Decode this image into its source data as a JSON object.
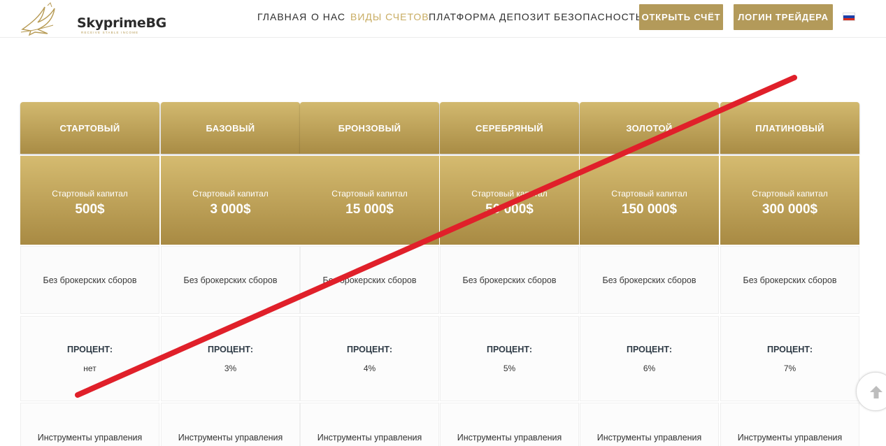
{
  "header": {
    "logo_text": "SkyprimeBG",
    "logo_tagline": "RECEIVE STABLE INCOME",
    "nav": [
      {
        "label": "ГЛАВНАЯ"
      },
      {
        "label": "О НАС"
      },
      {
        "label": "ВИДЫ СЧЕТОВ",
        "active": true
      },
      {
        "label": "ПЛАТФОРМА"
      },
      {
        "label": "ДЕПОЗИТ"
      },
      {
        "label": "БЕЗОПАСНОСТЬ"
      }
    ],
    "open_account_label": "ОТКРЫТЬ СЧЁТ",
    "trader_login_label": "ЛОГИН ТРЕЙДЕРА",
    "language_flag": "ru-flag-icon"
  },
  "accounts": [
    {
      "name": "СТАРТОВЫЙ",
      "capital_label": "Стартовый капитал",
      "capital": "500$",
      "fees": "Без брокерских сборов",
      "percent_label": "ПРОЦЕНТ:",
      "percent": "нет",
      "tools": "Инструменты управления"
    },
    {
      "name": "БАЗОВЫЙ",
      "capital_label": "Стартовый капитал",
      "capital": "3 000$",
      "fees": "Без брокерских сборов",
      "percent_label": "ПРОЦЕНТ:",
      "percent": "3%",
      "tools": "Инструменты управления"
    },
    {
      "name": "БРОНЗОВЫЙ",
      "capital_label": "Стартовый капитал",
      "capital": "15 000$",
      "fees": "Без брокерских сборов",
      "percent_label": "ПРОЦЕНТ:",
      "percent": "4%",
      "tools": "Инструменты управления"
    },
    {
      "name": "СЕРЕБРЯНЫЙ",
      "capital_label": "Стартовый капитал",
      "capital": "50 000$",
      "fees": "Без брокерских сборов",
      "percent_label": "ПРОЦЕНТ:",
      "percent": "5%",
      "tools": "Инструменты управления"
    },
    {
      "name": "ЗОЛОТОЙ",
      "capital_label": "Стартовый капитал",
      "capital": "150 000$",
      "fees": "Без брокерских сборов",
      "percent_label": "ПРОЦЕНТ:",
      "percent": "6%",
      "tools": "Инструменты управления"
    },
    {
      "name": "ПЛАТИНОВЫЙ",
      "capital_label": "Стартовый капитал",
      "capital": "300 000$",
      "fees": "Без брокерских сборов",
      "percent_label": "ПРОЦЕНТ:",
      "percent": "7%",
      "tools": "Инструменты управления"
    }
  ],
  "colors": {
    "gold_top": "#d2b96f",
    "gold_bottom": "#a98c45",
    "nav_active": "#c8ac62",
    "button": "#b39a5a",
    "strike": "#e0202a"
  },
  "scroll_top_icon": "arrow-up-icon"
}
